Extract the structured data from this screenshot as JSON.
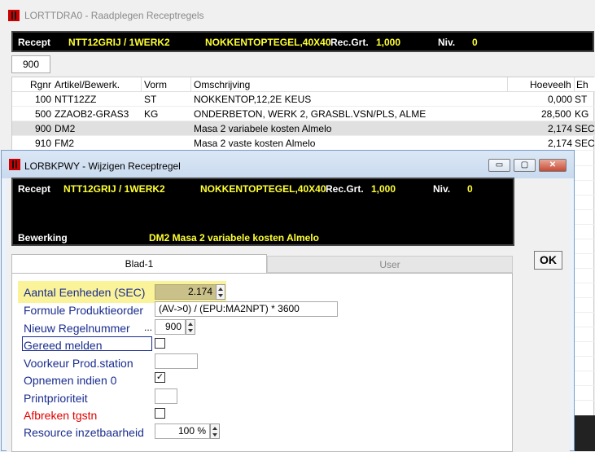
{
  "main_window": {
    "title": "LORTTDRA0 - Raadplegen Receptregels",
    "header": {
      "recept_label": "Recept",
      "recept_value": "NTT12GRIJ / 1WERK2",
      "description": "NOKKENTOPTEGEL,40X40",
      "recgrt_label": "Rec.Grt.",
      "recgrt_value": "1,000",
      "niv_label": "Niv.",
      "niv_value": "0"
    },
    "filter_value": "900",
    "grid": {
      "columns": [
        "Rgnr",
        "Artikel/Bewerk.",
        "Vorm",
        "Omschrijving",
        "Hoeveelh",
        "Eh"
      ],
      "rows": [
        {
          "rgnr": "100",
          "artikel": "NTT12ZZ",
          "vorm": "ST",
          "omschrijving": "NOKKENTOP,12,2E KEUS",
          "hoeveelh": "0,000",
          "eh": "ST"
        },
        {
          "rgnr": "500",
          "artikel": "ZZAOB2-GRAS3",
          "vorm": "KG",
          "omschrijving": "ONDERBETON, WERK 2, GRASBL.VSN/PLS, ALME",
          "hoeveelh": "28,500",
          "eh": "KG"
        },
        {
          "rgnr": "900",
          "artikel": "DM2",
          "vorm": "",
          "omschrijving": "Masa 2 variabele kosten Almelo",
          "hoeveelh": "2,174",
          "eh": "SEC"
        },
        {
          "rgnr": "910",
          "artikel": "FM2",
          "vorm": "",
          "omschrijving": "Masa 2 vaste kosten Almelo",
          "hoeveelh": "2,174",
          "eh": "SEC"
        }
      ]
    }
  },
  "dialog": {
    "title": "LORBKPWY - Wijzigen Receptregel",
    "controls": {
      "minimize": "▭",
      "maximize": "▢",
      "close": "✕"
    },
    "header": {
      "recept_label": "Recept",
      "recept_value": "NTT12GRIJ / 1WERK2",
      "description": "NOKKENTOPTEGEL,40X40",
      "recgrt_label": "Rec.Grt.",
      "recgrt_value": "1,000",
      "niv_label": "Niv.",
      "niv_value": "0",
      "bewerking_label": "Bewerking",
      "bewerking_value": "DM2  Masa 2 variabele kosten Almelo"
    },
    "tabs": [
      "Blad-1",
      "User"
    ],
    "ok_label": "OK",
    "fields": {
      "aantal_label": "Aantal Eenheden (SEC)",
      "aantal_value": "2.174",
      "formule_label": "Formule Produktieorder",
      "formule_value": "(AV->0) / (EPU:MA2NPT) * 3600",
      "nieuw_label": "Nieuw Regelnummer",
      "nieuw_dots": "...",
      "nieuw_value": "900",
      "gereed_label": "Gereed melden",
      "voorkeur_label": "Voorkeur Prod.station",
      "voorkeur_value": "",
      "opnemen_label": "Opnemen indien 0",
      "printprio_label": "Printprioriteit",
      "printprio_value": "",
      "afbreken_label": "Afbreken tgstn",
      "resource_label": "Resource inzetbaarheid",
      "resource_value": "100 %",
      "check_mark": "✓"
    },
    "checkboxes": {
      "gereed": false,
      "opnemen": true,
      "afbreken": false
    }
  }
}
